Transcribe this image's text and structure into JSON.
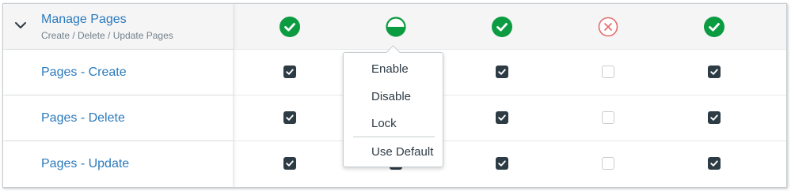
{
  "group": {
    "title": "Manage Pages",
    "subtitle": "Create / Delete / Update Pages",
    "statuses": [
      "enabled-icon",
      "partial-icon",
      "enabled-icon",
      "disabled-icon",
      "enabled-icon"
    ]
  },
  "permissions": [
    {
      "label": "Pages - Create",
      "checks": [
        true,
        true,
        true,
        false,
        true
      ]
    },
    {
      "label": "Pages - Delete",
      "checks": [
        true,
        true,
        true,
        false,
        true
      ]
    },
    {
      "label": "Pages - Update",
      "checks": [
        true,
        true,
        true,
        false,
        true
      ]
    }
  ],
  "menu": {
    "items": [
      "Enable",
      "Disable",
      "Lock",
      "Use Default"
    ]
  },
  "colors": {
    "link": "#2b7abc",
    "enabled": "#0b9b41",
    "disabled": "#e66b6b",
    "checked": "#2d3b45",
    "subtitle": "#73818c"
  }
}
